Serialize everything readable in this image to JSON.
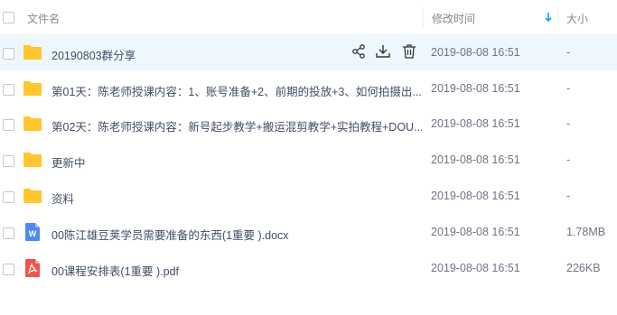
{
  "header": {
    "name_label": "文件名",
    "time_label": "修改时间",
    "size_label": "大小",
    "sort_icon": "sort-down-arrow-icon"
  },
  "colors": {
    "accent": "#06a7ff",
    "selected_row_bg": "#eef7fe",
    "folder": "#ffc62e",
    "docx": "#4d8bf0",
    "pdf": "#f0544c"
  },
  "rows": [
    {
      "name": "20190803群分享",
      "time": "2019-08-08 16:51",
      "size": "-",
      "type": "folder",
      "selected": true
    },
    {
      "name": "第01天：陈老师授课内容：1、账号准备+2、前期的投放+3、如何拍摄出...",
      "time": "2019-08-08 16:51",
      "size": "-",
      "type": "folder"
    },
    {
      "name": "第02天：陈老师授课内容：新号起步教学+搬运混剪教学+实拍教程+DOU...",
      "time": "2019-08-08 16:51",
      "size": "-",
      "type": "folder"
    },
    {
      "name": "更新中",
      "time": "2019-08-08 16:51",
      "size": "-",
      "type": "folder"
    },
    {
      "name": "资料",
      "time": "2019-08-08 16:51",
      "size": "-",
      "type": "folder"
    },
    {
      "name": "00陈江雄豆荚学员需要准备的东西(1重要 ).docx",
      "time": "2019-08-08 16:51",
      "size": "1.78MB",
      "type": "docx",
      "badge": "W"
    },
    {
      "name": "00课程安排表(1重要 ).pdf",
      "time": "2019-08-08 16:51",
      "size": "226KB",
      "type": "pdf"
    }
  ],
  "row_actions": [
    "share-icon",
    "download-icon",
    "delete-icon"
  ]
}
